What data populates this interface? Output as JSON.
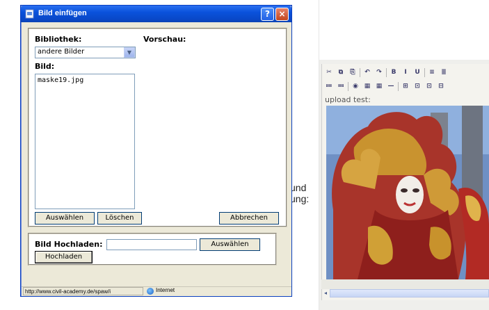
{
  "dialog": {
    "title": "Bild einfügen",
    "help_button": "?",
    "close_button": "×",
    "library_label": "Bibliothek:",
    "library_selected": "andere Bilder",
    "preview_label": "Vorschau:",
    "image_label": "Bild:",
    "files": [
      "maske19.jpg"
    ],
    "select_button": "Auswählen",
    "delete_button": "Löschen",
    "cancel_button": "Abbrechen",
    "upload_label": "Bild Hochladen:",
    "upload_field_value": "",
    "browse_button": "Auswählen",
    "upload_button": "Hochladen"
  },
  "status_bar": {
    "url": "http://www.civil-academy.de/spaw/i",
    "zone": "Internet"
  },
  "editor": {
    "toolbar_row1": [
      "✂",
      "⧉",
      "⎘",
      "↶",
      "↷",
      "B",
      "I",
      "U",
      "≡",
      "≣"
    ],
    "toolbar_row2": [
      "≔",
      "≕",
      "◉",
      "▦",
      "▦",
      "—",
      "⊞",
      "⊡",
      "⊡",
      "⊟"
    ],
    "upload_label": "upload test:",
    "side_text_1": "und",
    "side_text_2": "ung:",
    "image_alt": "venetian-carnival-mask-photo",
    "scroll_arrow": "◂"
  }
}
